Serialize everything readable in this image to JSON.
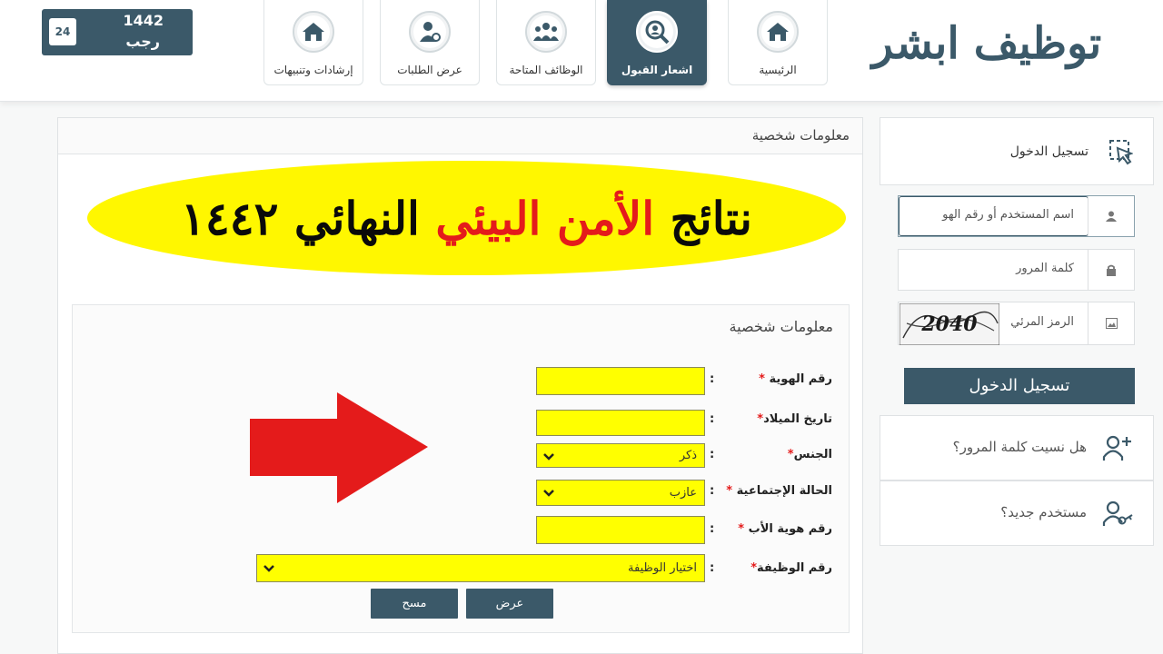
{
  "header": {
    "logo_text_1": "ابشر",
    "logo_text_2": "توظيف",
    "nav": [
      {
        "label": "الرئيسية",
        "icon": "home-icon"
      },
      {
        "label": "اشعار القبول",
        "icon": "acceptance-search-icon"
      },
      {
        "label": "الوظائف المتاحة",
        "icon": "team-icon"
      },
      {
        "label": "عرض الطلبات",
        "icon": "user-requests-icon"
      },
      {
        "label": "إرشادات وتنبيهات",
        "icon": "home-icon"
      }
    ],
    "date": {
      "day": "24",
      "month": "رجب",
      "year": "1442"
    }
  },
  "main": {
    "panel_title": "معلومات شخصية",
    "banner": {
      "part1": "نتائج",
      "part2": "الأمن البيئي",
      "part3": "النهائي ١٤٤٢"
    },
    "inner_title": "معلومات شخصية",
    "fields": [
      {
        "label": "رقم الهوية",
        "star": "*",
        "colon": ":"
      },
      {
        "label": "تاريخ الميلاد",
        "star": "*",
        "colon": ":"
      },
      {
        "label": "الجنس",
        "star": "*",
        "colon": ":",
        "value": "ذكر"
      },
      {
        "label": "الحالة الإجتماعية",
        "star": "*",
        "colon": ":",
        "value": "عازب"
      },
      {
        "label": "رقم هوية الأب",
        "star": "*",
        "colon": ":"
      },
      {
        "label": "رقم الوظيفة",
        "star": "*",
        "colon": ":",
        "value": "اختيار الوظيفة"
      }
    ],
    "buttons": {
      "view": "عرض",
      "clear": "مسح"
    },
    "colors": {
      "primary": "#3b5969",
      "highlight": "#ffff00",
      "arrow": "#e41b1b"
    }
  },
  "sidebar": {
    "login_title": "تسجيل الدخول",
    "username_placeholder": "اسم المستخدم أو رقم الهو",
    "password_placeholder": "كلمة المرور",
    "captcha_label": "الرمز المرئي",
    "captcha_text": "2040",
    "login_button": "تسجيل الدخول",
    "forgot_password": "هل نسيت كلمة المرور؟",
    "new_user": "مستخدم جديد؟"
  }
}
